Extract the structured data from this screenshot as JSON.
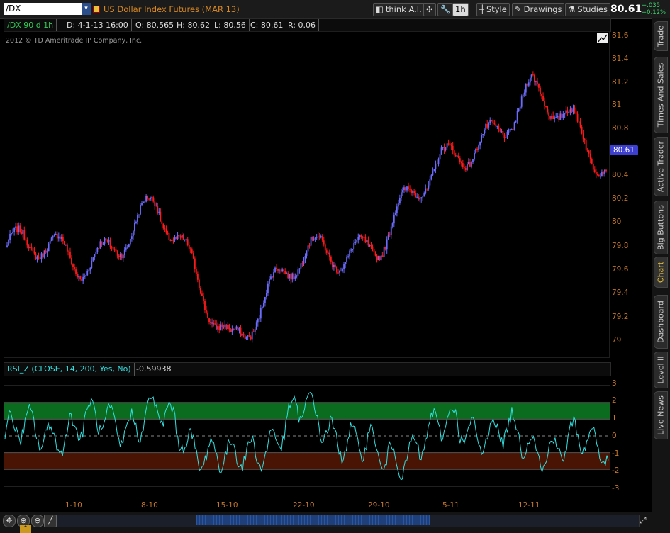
{
  "toolbar": {
    "symbol": "/DX",
    "instrument": "US Dollar Index Futures (MAR 13)",
    "think_label": "think A.I.",
    "timeframe": "1h",
    "style_label": "Style",
    "drawings_label": "Drawings",
    "studies_label": "Studies",
    "last_price": "80.61",
    "change_points": "+.035",
    "change_percent": "+0.12%"
  },
  "info_bar": {
    "symbol_period": "/DX 90 d 1h",
    "date": "D: 4-1-13 16:00",
    "open": "O: 80.565",
    "high": "H: 80.62",
    "low": "L: 80.56",
    "close": "C: 80.61",
    "range": "R: 0.06"
  },
  "copyright": "2012 © TD Ameritrade IP Company, Inc.",
  "price_axis": {
    "ticks": [
      "81.6",
      "81.4",
      "81.2",
      "81",
      "80.8",
      "80.6",
      "80.4",
      "80.2",
      "80",
      "79.8",
      "79.6",
      "79.4",
      "79.2",
      "79"
    ],
    "current_tag": "80.61"
  },
  "study": {
    "label": "RSI_Z (CLOSE, 14, 200, Yes, No)",
    "value": "-0.59938",
    "ticks": [
      "3",
      "2",
      "1",
      "0",
      "-1",
      "-2",
      "-3"
    ]
  },
  "date_axis": [
    "1-10",
    "8-10",
    "15-10",
    "22-10",
    "29-10",
    "5-11",
    "12-11"
  ],
  "side_tabs": [
    "Trade",
    "Times And Sales",
    "Active Trader",
    "Big Buttons",
    "Chart",
    "Dashboard",
    "Level II",
    "Live News"
  ],
  "active_tab": "Chart",
  "colors": {
    "candle_up": "#6b6bff",
    "candle_down": "#ff1a1a",
    "rsi_line": "#33e0e0",
    "overbought_zone": "#0b6b1e",
    "oversold_zone": "#4a1405",
    "axis_text": "#c2762a"
  },
  "chart_data": [
    {
      "type": "line",
      "title": "/DX 90 d 1h",
      "x": [
        "1-10",
        "8-10",
        "15-10",
        "22-10",
        "29-10",
        "5-11",
        "12-11"
      ],
      "series": [
        {
          "name": "/DX",
          "values": [
            79.75,
            80.15,
            79.1,
            79.75,
            79.95,
            80.65,
            81.15
          ]
        }
      ],
      "ylim": [
        78.9,
        81.7
      ],
      "last": 80.61
    },
    {
      "type": "line",
      "title": "RSI_Z (CLOSE, 14, 200, Yes, No)",
      "x": [
        "1-10",
        "8-10",
        "15-10",
        "22-10",
        "29-10",
        "5-11",
        "12-11"
      ],
      "series": [
        {
          "name": "RSI_Z",
          "values": [
            0.5,
            1.2,
            -1.8,
            1.5,
            -1.5,
            0.8,
            -0.5
          ]
        }
      ],
      "ylim": [
        -3,
        3
      ],
      "bands": [
        [
          1,
          2
        ],
        [
          -2,
          -1
        ]
      ],
      "last": -0.59938
    }
  ]
}
